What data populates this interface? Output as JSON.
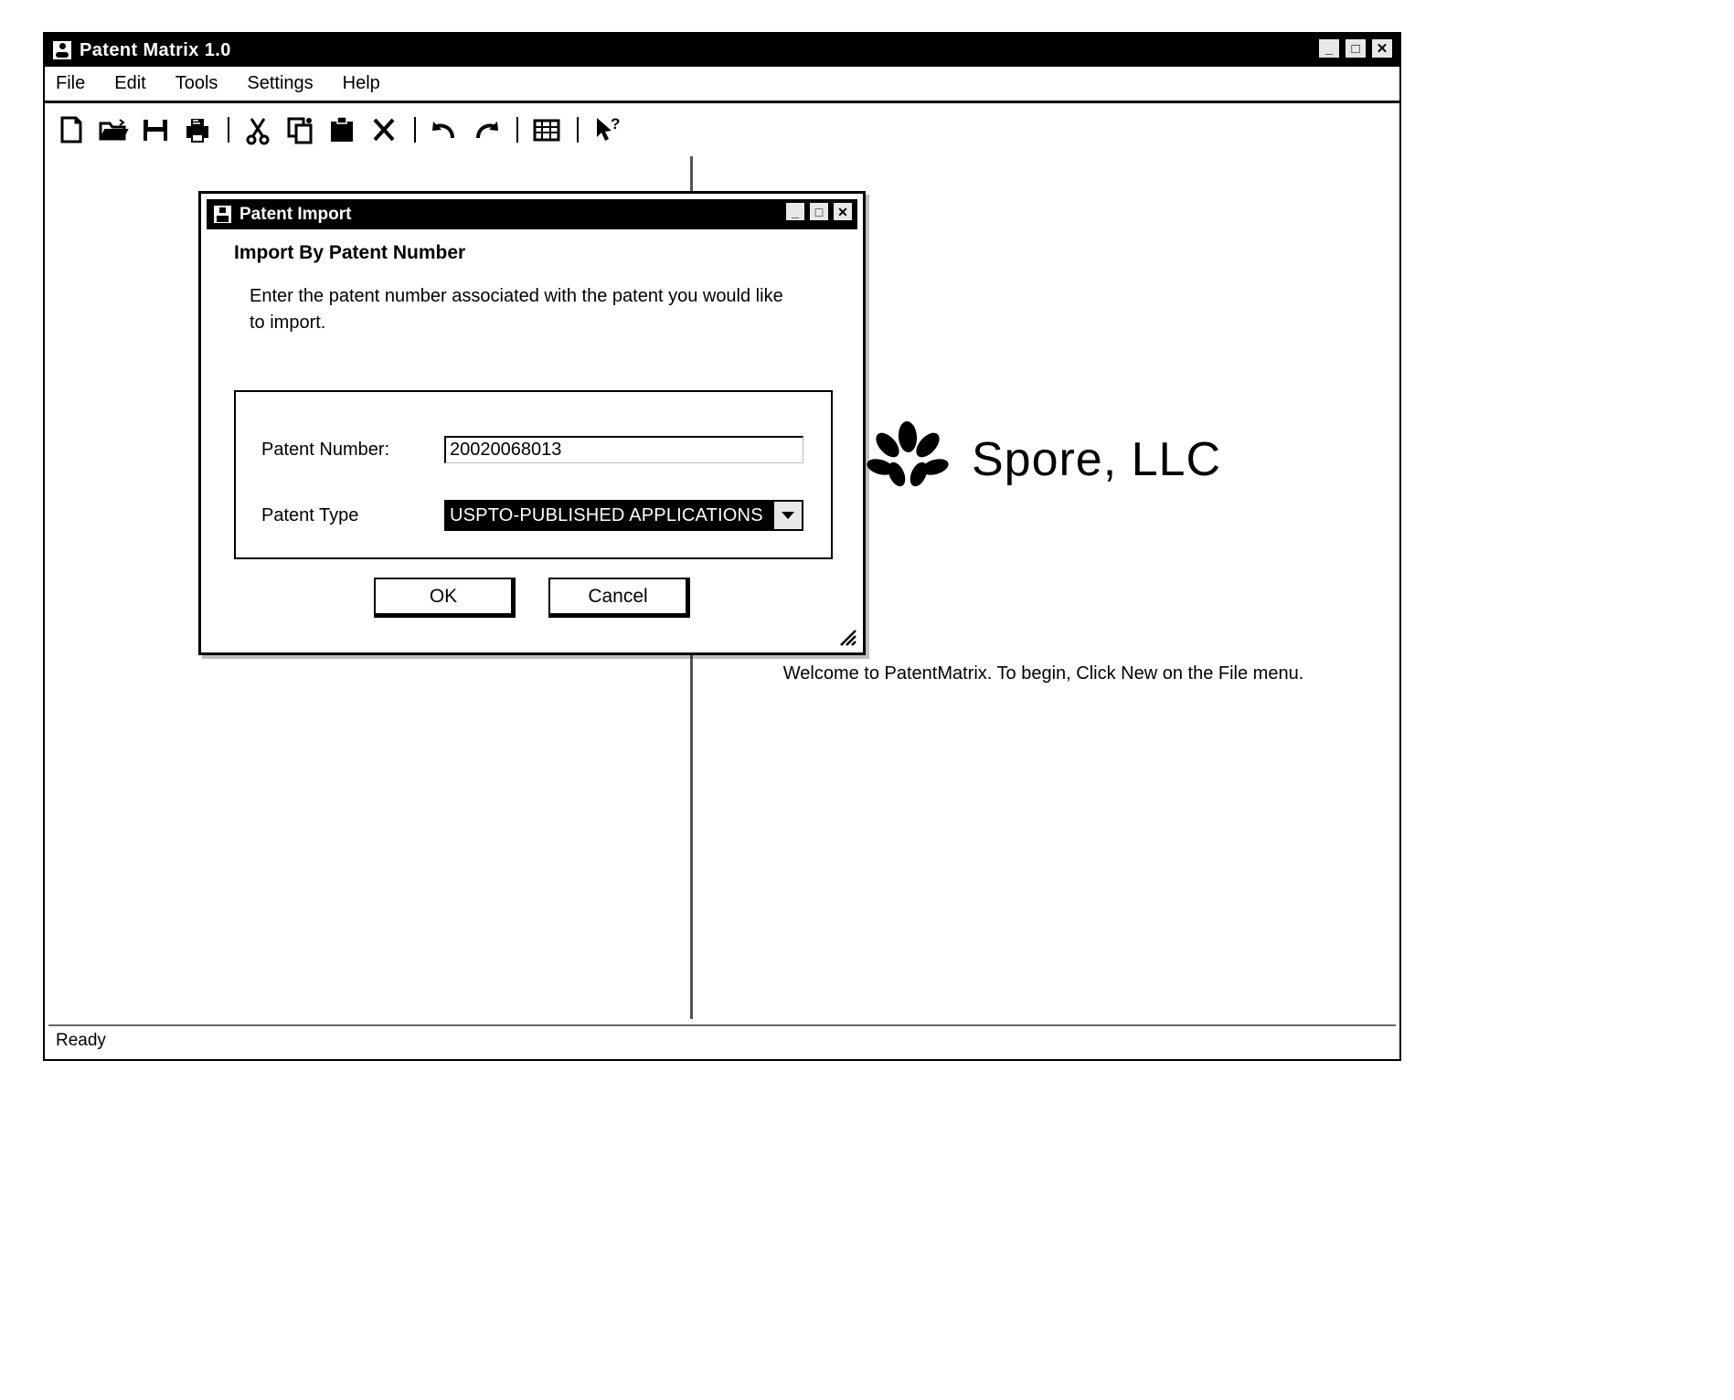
{
  "window": {
    "title": "Patent Matrix 1.0",
    "icon": "app-matrix-icon",
    "controls": {
      "minimize": "_",
      "maximize": "□",
      "close": "✕"
    }
  },
  "menu": {
    "items": [
      {
        "label": "File"
      },
      {
        "label": "Edit"
      },
      {
        "label": "Tools"
      },
      {
        "label": "Settings"
      },
      {
        "label": "Help"
      }
    ]
  },
  "toolbar": {
    "items": [
      {
        "name": "new-document-icon"
      },
      {
        "name": "open-folder-icon"
      },
      {
        "name": "save-icon"
      },
      {
        "name": "print-icon"
      },
      {
        "name": "separator"
      },
      {
        "name": "cut-scissors-icon"
      },
      {
        "name": "copy-icon"
      },
      {
        "name": "paste-icon"
      },
      {
        "name": "delete-x-icon"
      },
      {
        "name": "separator"
      },
      {
        "name": "undo-arrow-icon"
      },
      {
        "name": "redo-arrow-icon"
      },
      {
        "name": "separator"
      },
      {
        "name": "report-grid-icon"
      },
      {
        "name": "separator"
      },
      {
        "name": "help-pointer-icon"
      }
    ]
  },
  "main": {
    "brand_name": "Spore, LLC",
    "brand_logo": "spore-flower-logo",
    "welcome_text": "Welcome to PatentMatrix.   To begin, Click New on the File menu."
  },
  "status_bar": {
    "text": "Ready"
  },
  "dialog": {
    "title": "Patent Import",
    "icon": "patent-import-icon",
    "controls": {
      "minimize": "_",
      "maximize": "□",
      "close": "✕"
    },
    "heading": "Import By Patent Number",
    "instruction": "Enter the patent number associated with the patent you would like to import.",
    "fields": {
      "patent_number": {
        "label": "Patent Number:",
        "value": "20020068013",
        "placeholder": ""
      },
      "patent_type": {
        "label": "Patent Type",
        "value": "USPTO-PUBLISHED APPLICATIONS",
        "arrow": "▼",
        "options": [
          "USPTO-PUBLISHED APPLICATIONS"
        ]
      }
    },
    "buttons": {
      "ok": "OK",
      "cancel": "Cancel"
    }
  },
  "colors": {
    "titlebar_bg": "#000000",
    "titlebar_fg": "#ffffff",
    "window_bg": "#ffffff",
    "selection_bg": "#000000",
    "selection_fg": "#ffffff",
    "border": "#000000"
  }
}
